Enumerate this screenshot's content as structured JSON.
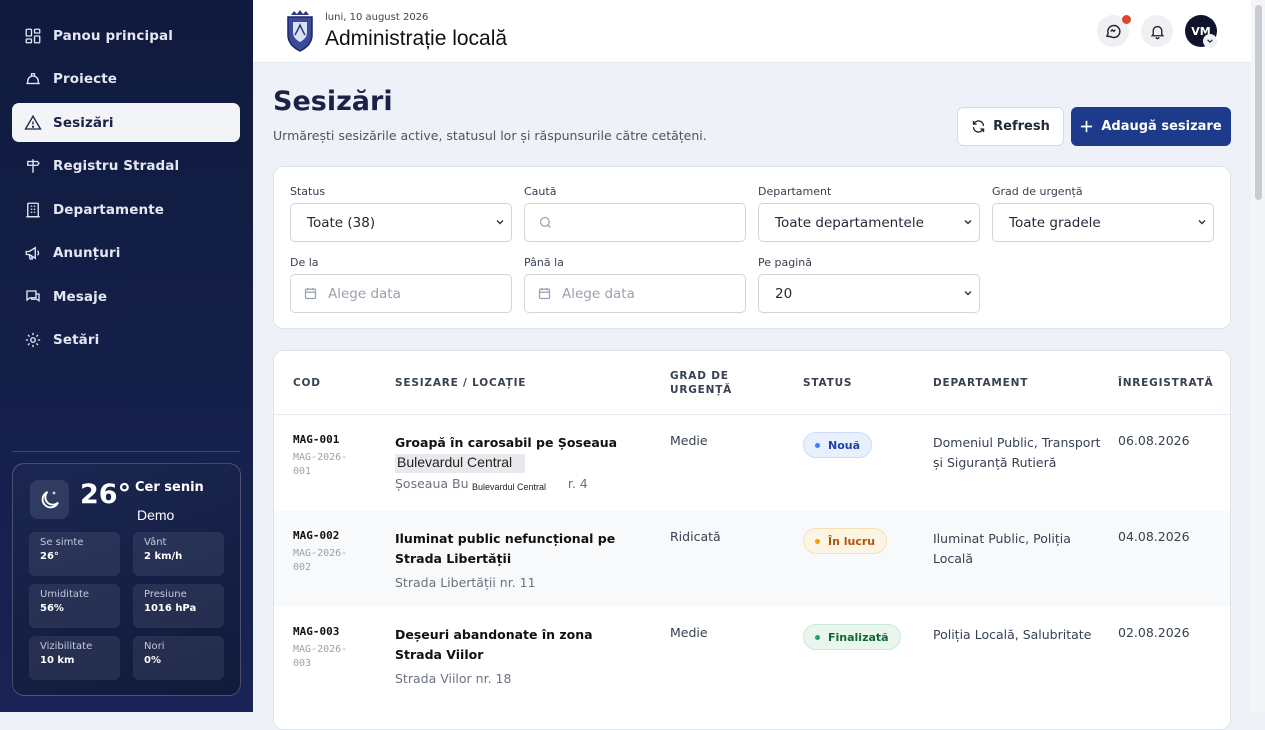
{
  "sidebar": {
    "items": [
      {
        "label": "Panou principal",
        "icon": "dashboard-icon"
      },
      {
        "label": "Proiecte",
        "icon": "helmet-icon"
      },
      {
        "label": "Sesizări",
        "icon": "warning-icon"
      },
      {
        "label": "Registru Stradal",
        "icon": "signpost-icon"
      },
      {
        "label": "Departamente",
        "icon": "building-icon"
      },
      {
        "label": "Anunțuri",
        "icon": "megaphone-icon"
      },
      {
        "label": "Mesaje",
        "icon": "chat-icon"
      },
      {
        "label": "Setări",
        "icon": "gear-icon"
      }
    ],
    "active": "Sesizări"
  },
  "weather": {
    "temp": "26°",
    "desc": "Cer senin",
    "location": "Demo",
    "cells": [
      {
        "label": "Se simte",
        "value": "26°"
      },
      {
        "label": "Vânt",
        "value": "2 km/h"
      },
      {
        "label": "Umiditate",
        "value": "56%"
      },
      {
        "label": "Presiune",
        "value": "1016 hPa"
      },
      {
        "label": "Vizibilitate",
        "value": "10 km"
      },
      {
        "label": "Nori",
        "value": "0%"
      }
    ]
  },
  "header": {
    "date": "luni, 10 august 2026",
    "title": "Administrație locală",
    "avatar": "VM"
  },
  "page": {
    "title": "Sesizări",
    "subtitle": "Urmărești sesizările active, statusul lor și răspunsurile către cetățeni.",
    "refresh_label": "Refresh",
    "add_label": "Adaugă sesizare"
  },
  "filters": {
    "status_label": "Status",
    "status_value": "Toate (38)",
    "search_label": "Caută",
    "search_placeholder": "",
    "department_label": "Departament",
    "department_value": "Toate departamentele",
    "urgency_label": "Grad de urgență",
    "urgency_value": "Toate gradele",
    "from_label": "De la",
    "from_placeholder": "Alege data",
    "to_label": "Până la",
    "to_placeholder": "Alege data",
    "perpage_label": "Pe pagină",
    "perpage_value": "20"
  },
  "table": {
    "headers": [
      "COD",
      "SESIZARE / LOCAȚIE",
      "GRAD DE URGENȚĂ",
      "STATUS",
      "DEPARTAMENT",
      "ÎNREGISTRATĂ"
    ],
    "rows": [
      {
        "code": "MAG-001",
        "code_full": "MAG-2026-001",
        "title": "Groapă în carosabil pe Șoseaua",
        "location": "Șoseaua Bu                         r. 4",
        "urgency": "Medie",
        "status": "Nouă",
        "status_color": "#3b82f6",
        "department": "Domeniul Public, Transport și Siguranță Rutieră",
        "date": "06.08.2026",
        "tooltip": "Bulevardul Central",
        "tooltip_small": "Bulevardul Central"
      },
      {
        "code": "MAG-002",
        "code_full": "MAG-2026-002",
        "title": "Iluminat public nefuncțional pe Strada Libertății",
        "location": "Strada Libertății nr. 11",
        "urgency": "Ridicată",
        "status": "În lucru",
        "status_color": "#f59e0b",
        "department": "Iluminat Public, Poliția Locală",
        "date": "04.08.2026"
      },
      {
        "code": "MAG-003",
        "code_full": "MAG-2026-003",
        "title": "Deșeuri abandonate în zona Strada Viilor",
        "location": "Strada Viilor nr. 18",
        "urgency": "Medie",
        "status": "Finalizată",
        "status_color": "#22a06b",
        "department": "Poliția Locală, Salubritate",
        "date": "02.08.2026"
      }
    ]
  }
}
